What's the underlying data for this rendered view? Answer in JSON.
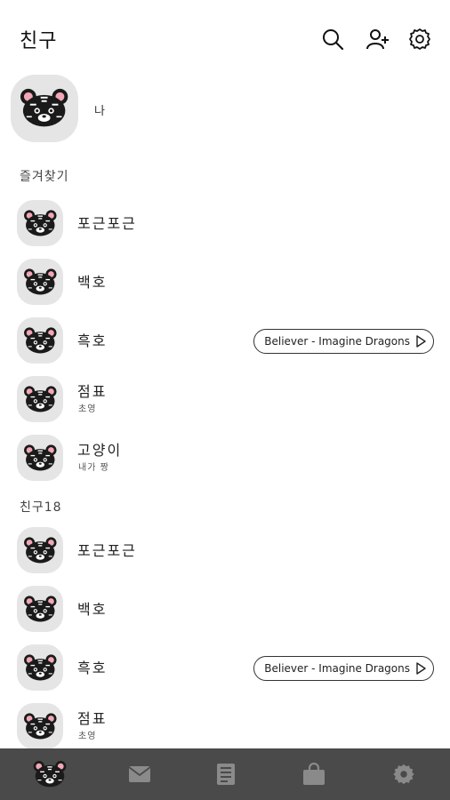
{
  "header": {
    "title": "친구",
    "icons": [
      "search-icon",
      "add-friend-icon",
      "settings-icon"
    ]
  },
  "me": {
    "name": "나"
  },
  "favorites": {
    "label": "즐겨찾기",
    "items": [
      {
        "name": "포근포근",
        "status": "",
        "music": ""
      },
      {
        "name": "백호",
        "status": "",
        "music": ""
      },
      {
        "name": "흑호",
        "status": "",
        "music": "Believer - Imagine Dragons"
      },
      {
        "name": "점표",
        "status": "초영",
        "music": ""
      },
      {
        "name": "고양이",
        "status": "내가 짱",
        "music": ""
      }
    ]
  },
  "friends": {
    "label": "친구18",
    "items": [
      {
        "name": "포근포근",
        "status": "",
        "music": ""
      },
      {
        "name": "백호",
        "status": "",
        "music": ""
      },
      {
        "name": "흑호",
        "status": "",
        "music": "Believer - Imagine Dragons"
      },
      {
        "name": "점표",
        "status": "초영",
        "music": ""
      }
    ]
  },
  "tabbar": {
    "tabs": [
      "friends-tab-icon",
      "chats-tab-icon",
      "news-tab-icon",
      "shop-tab-icon",
      "more-settings-icon"
    ],
    "selected": "friends-tab-icon"
  },
  "colors": {
    "background": "#ffffff",
    "avatar_bg": "#e5e5e5",
    "tabbar_bg": "#4a4a4a",
    "tab_icon_inactive": "#8a8a8a",
    "tiger_black": "#1a1a1a",
    "tiger_ear_pink": "#f2a6b8"
  }
}
